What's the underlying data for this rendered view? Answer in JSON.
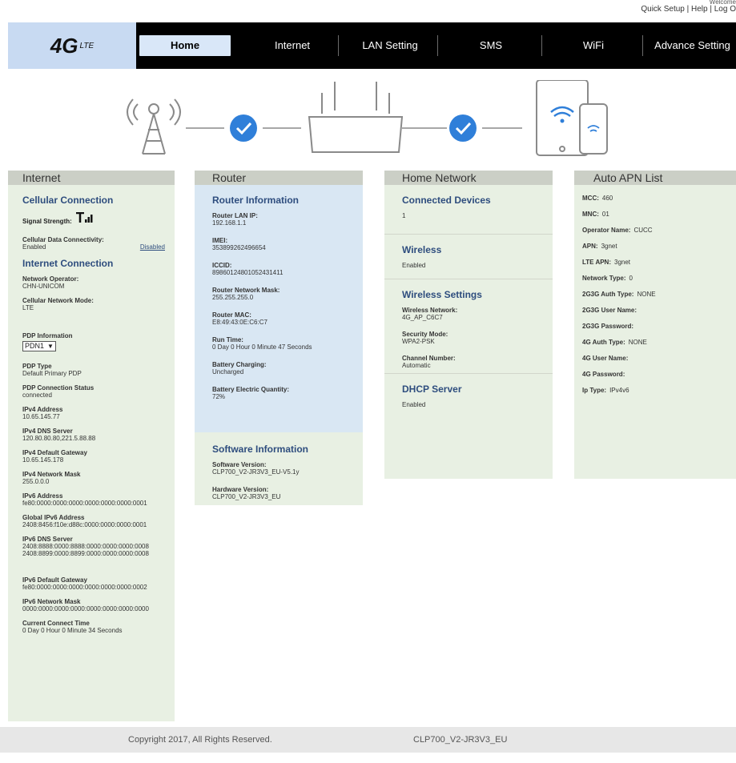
{
  "toplinks": {
    "welcome": "Welcome",
    "quick_setup": "Quick Setup",
    "help": "Help",
    "logout": "Log O"
  },
  "logo": {
    "four": "4G",
    "lte": "LTE"
  },
  "nav": [
    "Home",
    "Internet",
    "LAN Setting",
    "SMS",
    "WiFi",
    "Advance Setting"
  ],
  "internet": {
    "title": "Internet",
    "cellular_heading": "Cellular Connection",
    "signal_label": "Signal Strength:",
    "data_conn_label": "Cellular Data Connectivity:",
    "data_conn_value": "Enabled",
    "data_conn_link": "Disabled",
    "internet_heading": "Internet Connection",
    "operator_label": "Network Operator:",
    "operator_value": "CHN-UNICOM",
    "mode_label": "Cellular Network Mode:",
    "mode_value": "LTE",
    "pdp_label": "PDP Information",
    "pdp_select": "PDN1",
    "pdp_type_label": "PDP Type",
    "pdp_type_value": "Default Primary PDP",
    "pdp_status_label": "PDP Connection Status",
    "pdp_status_value": "connected",
    "ipv4_label": "IPv4 Address",
    "ipv4_value": "10.65.145.77",
    "dns_label": "IPv4 DNS Server",
    "dns_value": "120.80.80.80,221.5.88.88",
    "gw_label": "IPv4 Default Gateway",
    "gw_value": "10.65.145.178",
    "mask_label": "IPv4 Network Mask",
    "mask_value": "255.0.0.0",
    "ipv6_label": "IPv6 Address",
    "ipv6_value": "fe80:0000:0000:0000:0000:0000:0000:0001",
    "gipv6_label": "Global IPv6 Address",
    "gipv6_value": "2408:8456:f10e:d88c:0000:0000:0000:0001",
    "dns6_label": "IPv6 DNS Server",
    "dns6_value1": "2408:8888:0000:8888:0000:0000:0000:0008",
    "dns6_value2": "2408:8899:0000:8899:0000:0000:0000:0008",
    "gw6_label": "IPv6 Default Gateway",
    "gw6_value": "fe80:0000:0000:0000:0000:0000:0000:0002",
    "mask6_label": "IPv6 Network Mask",
    "mask6_value": "0000:0000:0000:0000:0000:0000:0000:0000",
    "time_label": "Current Connect Time",
    "time_value": "0 Day 0 Hour 0 Minute 34 Seconds"
  },
  "router": {
    "title": "Router",
    "info_heading": "Router Information",
    "lan_ip_label": "Router LAN IP:",
    "lan_ip_value": "192.168.1.1",
    "imei_label": "IMEI:",
    "imei_value": "353899262496654",
    "iccid_label": "ICCID:",
    "iccid_value": "89860124801052431411",
    "mask_label": "Router Network Mask:",
    "mask_value": "255.255.255.0",
    "mac_label": "Router MAC:",
    "mac_value": "E8:49:43:0E:C6:C7",
    "run_label": "Run Time:",
    "run_value": "0 Day 0 Hour 0 Minute 47 Seconds",
    "charging_label": "Battery Charging:",
    "charging_value": "Uncharged",
    "battery_label": "Battery Electric Quantity:",
    "battery_value": "72%",
    "soft_heading": "Software Information",
    "sw_label": "Software Version:",
    "sw_value": "CLP700_V2-JR3V3_EU-V5.1y",
    "hw_label": "Hardware Version:",
    "hw_value": "CLP700_V2-JR3V3_EU"
  },
  "homenet": {
    "title": "Home Network",
    "devices_heading": "Connected Devices",
    "devices_value": "1",
    "wireless_heading": "Wireless",
    "wireless_value": "Enabled",
    "ws_heading": "Wireless Settings",
    "ssid_label": "Wireless Network:",
    "ssid_value": "4G_AP_C6C7",
    "sec_label": "Security Mode:",
    "sec_value": "WPA2-PSK",
    "ch_label": "Channel Number:",
    "ch_value": "Automatic",
    "dhcp_heading": "DHCP Server",
    "dhcp_value": "Enabled"
  },
  "apn": {
    "title": "Auto APN List",
    "rows": [
      {
        "label": "MCC:",
        "value": "460"
      },
      {
        "label": "MNC:",
        "value": "01"
      },
      {
        "label": "Operator Name:",
        "value": "CUCC"
      },
      {
        "label": "APN:",
        "value": "3gnet"
      },
      {
        "label": "LTE APN:",
        "value": "3gnet"
      },
      {
        "label": "Network Type:",
        "value": "0"
      },
      {
        "label": "2G3G Auth Type:",
        "value": "NONE"
      },
      {
        "label": "2G3G User Name:",
        "value": ""
      },
      {
        "label": "2G3G Password:",
        "value": ""
      },
      {
        "label": "4G Auth Type:",
        "value": "NONE"
      },
      {
        "label": "4G User Name:",
        "value": ""
      },
      {
        "label": "4G Password:",
        "value": ""
      },
      {
        "label": "Ip Type:",
        "value": "IPv4v6"
      }
    ]
  },
  "footer": {
    "copyright": "Copyright 2017, All Rights Reserved.",
    "model": "CLP700_V2-JR3V3_EU"
  },
  "colors": {
    "nav_bg": "#000000",
    "logo_bg": "#c8daf2",
    "active_tab": "#d9e7f8",
    "check_blue": "#2f7fd9",
    "panel_bg": "#e8f0e3",
    "router_info_bg": "#d9e7f3",
    "heading": "#2e4d7e"
  }
}
